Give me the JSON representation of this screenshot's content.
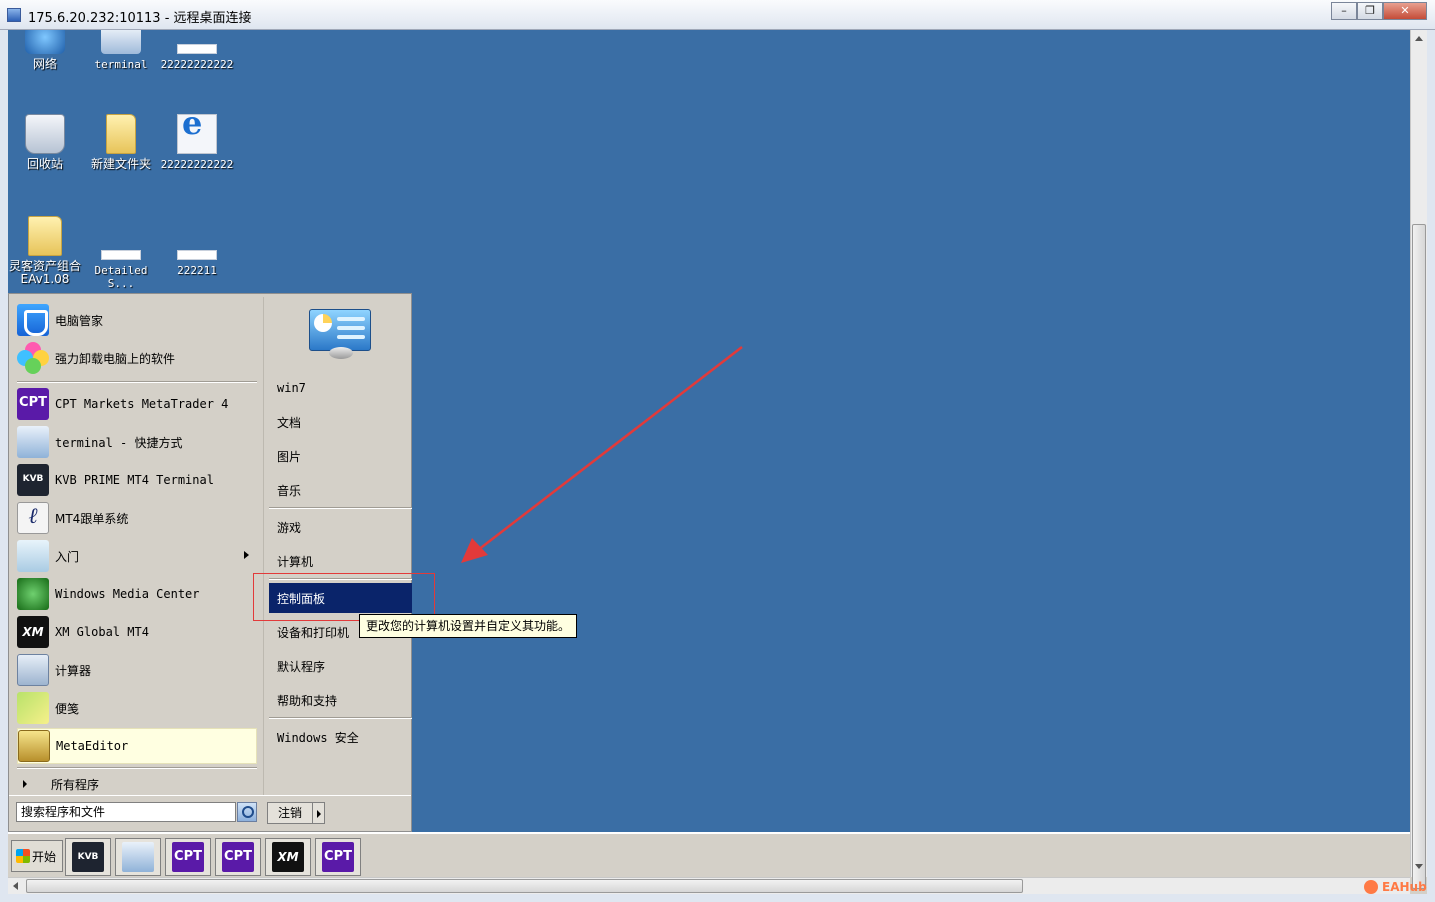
{
  "window": {
    "title": "175.6.20.232:10113 - 远程桌面连接",
    "minimize_glyph": "–",
    "restore_glyph": "❐",
    "close_glyph": "✕"
  },
  "desktop": {
    "icons": [
      {
        "label": "网络",
        "icon": "network-icon"
      },
      {
        "label": "terminal",
        "icon": "terminal-shortcut-icon"
      },
      {
        "label": "22222222222",
        "icon": "file-icon"
      },
      {
        "label": "回收站",
        "icon": "recycle-bin-icon"
      },
      {
        "label": "新建文件夹",
        "icon": "folder-icon"
      },
      {
        "label": "22222222222",
        "icon": "internet-explorer-icon"
      },
      {
        "label": "灵客资产组合EAv1.08",
        "icon": "folder-icon"
      },
      {
        "label": "DetailedS...",
        "icon": "file-icon"
      },
      {
        "label": "222211",
        "icon": "file-icon"
      }
    ]
  },
  "start_menu": {
    "pinned": [
      {
        "label": "电脑管家",
        "icon": "tencent-pc-manager-icon"
      },
      {
        "label": "强力卸载电脑上的软件",
        "icon": "clover-uninstaller-icon"
      }
    ],
    "recent": [
      {
        "label": "CPT Markets MetaTrader 4",
        "icon": "cpt-markets-icon",
        "badge": "CPT"
      },
      {
        "label": "terminal - 快捷方式",
        "icon": "terminal-shortcut-icon"
      },
      {
        "label": "KVB PRIME MT4 Terminal",
        "icon": "kvb-icon",
        "badge": "KVB"
      },
      {
        "label": "MT4跟单系统",
        "icon": "mt4-copy-icon",
        "badge": "ℓ"
      },
      {
        "label": "入门",
        "icon": "getting-started-icon",
        "has_submenu": true
      },
      {
        "label": "Windows Media Center",
        "icon": "windows-media-center-icon"
      },
      {
        "label": "XM Global MT4",
        "icon": "xm-icon",
        "badge": "XM"
      },
      {
        "label": "计算器",
        "icon": "calculator-icon"
      },
      {
        "label": "便笺",
        "icon": "sticky-notes-icon"
      },
      {
        "label": "MetaEditor",
        "icon": "metaeditor-icon",
        "highlighted": true
      }
    ],
    "all_programs": "所有程序",
    "search_placeholder": "搜索程序和文件",
    "logoff": "注销",
    "right": [
      {
        "label": "win7"
      },
      {
        "label": "文档"
      },
      {
        "label": "图片"
      },
      {
        "label": "音乐"
      },
      {
        "label": "游戏"
      },
      {
        "label": "计算机"
      },
      {
        "label": "控制面板",
        "selected": true
      },
      {
        "label": "设备和打印机"
      },
      {
        "label": "默认程序"
      },
      {
        "label": "帮助和支持"
      },
      {
        "label": "Windows 安全"
      }
    ],
    "tooltip": "更改您的计算机设置并自定义其功能。"
  },
  "taskbar": {
    "start_label": "开始",
    "buttons": [
      {
        "icon": "kvb-icon",
        "badge": "KVB"
      },
      {
        "icon": "terminal-shortcut-icon",
        "badge": ""
      },
      {
        "icon": "cpt-markets-icon",
        "badge": "CPT"
      },
      {
        "icon": "cpt-markets-icon",
        "badge": "CPT"
      },
      {
        "icon": "xm-icon",
        "badge": "XM"
      },
      {
        "icon": "cpt-markets-icon",
        "badge": "CPT"
      }
    ]
  },
  "watermark": "EAHub",
  "colors": {
    "desktop": "#3a6ea5",
    "selection": "#0a246a",
    "annotation_red": "#e23a3a",
    "tooltip_bg": "#ffffe1"
  }
}
